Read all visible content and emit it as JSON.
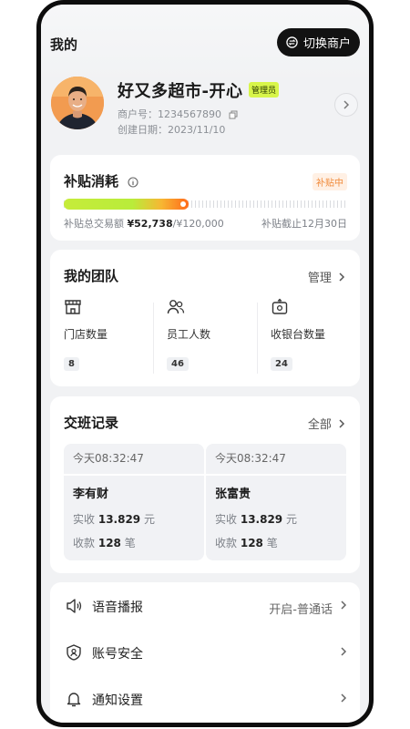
{
  "header": {
    "title": "我的",
    "switch_label": "切换商户"
  },
  "profile": {
    "store_name": "好又多超市-开心",
    "role_badge": "管理员",
    "merchant_no": "商户号：1234567890",
    "created": "创建日期：2023/11/10"
  },
  "subsidy": {
    "title": "补贴消耗",
    "status": "补贴中",
    "progress": 0.44,
    "total_label": "补贴总交易额",
    "amount": "¥52,738",
    "limit": "/¥120,000",
    "deadline": "补贴截止12月30日"
  },
  "team": {
    "title": "我的团队",
    "manage_label": "管理",
    "items": [
      {
        "label": "门店数量",
        "value": "8",
        "icon": "store-icon"
      },
      {
        "label": "员工人数",
        "value": "46",
        "icon": "users-icon"
      },
      {
        "label": "收银台数量",
        "value": "24",
        "icon": "cash-register-icon"
      }
    ]
  },
  "shifts": {
    "title": "交班记录",
    "all_label": "全部",
    "records": [
      {
        "time": "今天08:32:47",
        "name": "李有财",
        "received_label": "实收",
        "received": "13.829",
        "received_unit": "元",
        "count_label": "收款",
        "count": "128",
        "count_unit": "笔"
      },
      {
        "time": "今天08:32:47",
        "name": "张富贵",
        "received_label": "实收",
        "received": "13.829",
        "received_unit": "元",
        "count_label": "收款",
        "count": "128",
        "count_unit": "笔"
      }
    ]
  },
  "settings": [
    {
      "label": "语音播报",
      "value": "开启-普通话",
      "icon": "speaker-icon"
    },
    {
      "label": "账号安全",
      "value": "",
      "icon": "shield-user-icon"
    },
    {
      "label": "通知设置",
      "value": "",
      "icon": "bell-icon"
    }
  ],
  "colors": {
    "accent": "#d8f54a",
    "warning": "#f08a3a",
    "dark": "#121212"
  }
}
